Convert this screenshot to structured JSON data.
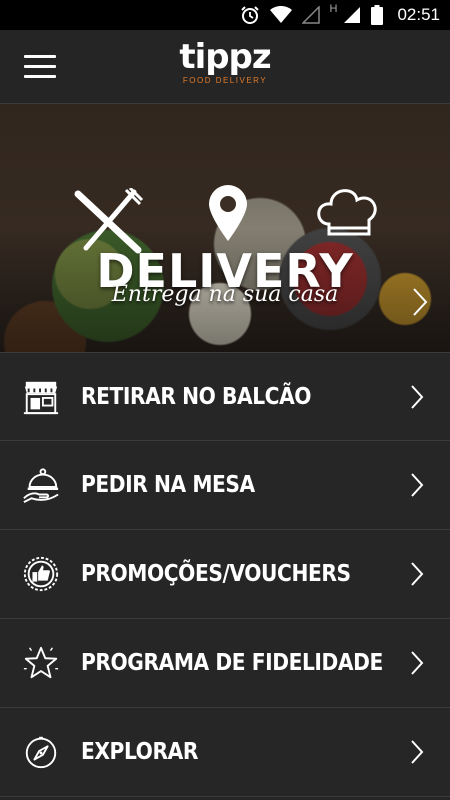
{
  "status_bar": {
    "time": "02:51",
    "network_letter": "H",
    "icons": [
      "alarm-icon",
      "wifi-icon",
      "signal-empty-icon",
      "signal-icon",
      "battery-icon"
    ]
  },
  "app_bar": {
    "menu_icon": "hamburger-menu-icon",
    "logo_name": "tippz",
    "logo_tagline": "FOOD DELIVERY"
  },
  "banner": {
    "title": "DELIVERY",
    "subtitle": "Entrega na sua casa",
    "icons": [
      "cutlery-icon",
      "location-pin-icon",
      "chef-hat-icon",
      "chevron-right-icon"
    ]
  },
  "menu": [
    {
      "label": "RETIRAR NO BALCÃO",
      "icon": "storefront-icon"
    },
    {
      "label": "PEDIR NA MESA",
      "icon": "serving-cloche-icon"
    },
    {
      "label": "PROMOÇÕES/VOUCHERS",
      "icon": "thumbs-up-badge-icon"
    },
    {
      "label": "PROGRAMA DE FIDELIDADE",
      "icon": "star-icon"
    },
    {
      "label": "EXPLORAR",
      "icon": "compass-icon"
    }
  ],
  "colors": {
    "background": "#262626",
    "accent": "#e07b2a",
    "divider": "#3a3a3a"
  }
}
